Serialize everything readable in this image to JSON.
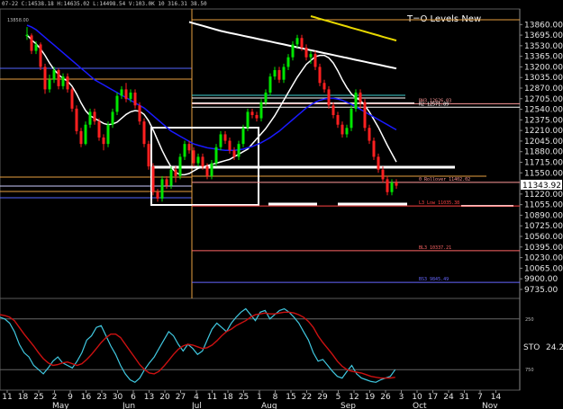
{
  "header": {
    "text": "07-22 C:14538.18 H:14635.02 L:14498.54 V:103.0K 10 316.31 38.50",
    "ref_value": "13858.00"
  },
  "chart_title": "T=O Levels New",
  "price_label": "11343.92",
  "chart_data": {
    "type": "candlestick",
    "price_axis": {
      "ylim": [
        9650,
        13990
      ],
      "ticks": [
        "13860.00",
        "13695.00",
        "13530.00",
        "13365.00",
        "13200.00",
        "13035.00",
        "12870.00",
        "12705.00",
        "12540.00",
        "12375.00",
        "12210.00",
        "12045.00",
        "11880.00",
        "11715.00",
        "11550.00",
        "11220.00",
        "11055.00",
        "10890.00",
        "10725.00",
        "10560.00",
        "10395.00",
        "10230.00",
        "10065.00",
        "9900.00",
        "9735.00"
      ]
    },
    "date_ticks": [
      "11",
      "18",
      "25",
      "2",
      "9",
      "16",
      "23",
      "30",
      "6",
      "13",
      "20",
      "27",
      "4",
      "11",
      "18",
      "25",
      "1",
      "8",
      "15",
      "22",
      "29",
      "5",
      "12",
      "19",
      "26",
      "3",
      "10",
      "17",
      "24",
      "31",
      "7",
      "14"
    ],
    "months": [
      "May",
      "Jun",
      "Jul",
      "Aug",
      "Sep",
      "Oct",
      "Nov"
    ],
    "candles": [
      [
        13680,
        13700,
        13820,
        13620
      ],
      [
        13690,
        13450,
        13720,
        13400
      ],
      [
        13450,
        13550,
        13600,
        13400
      ],
      [
        13550,
        13200,
        13580,
        13150
      ],
      [
        13200,
        12850,
        13250,
        12780
      ],
      [
        12850,
        13000,
        13080,
        12800
      ],
      [
        13000,
        13150,
        13200,
        12950
      ],
      [
        13150,
        12900,
        13180,
        12850
      ],
      [
        12900,
        13050,
        13100,
        12850
      ],
      [
        13050,
        12850,
        13100,
        12800
      ],
      [
        12850,
        12550,
        12880,
        12500
      ],
      [
        12550,
        12200,
        12600,
        12150
      ],
      [
        12200,
        12000,
        12250,
        11950
      ],
      [
        12000,
        12300,
        12350,
        11980
      ],
      [
        12300,
        12500,
        12550,
        12250
      ],
      [
        12500,
        12350,
        12550,
        12300
      ],
      [
        12350,
        12100,
        12400,
        12050
      ],
      [
        12100,
        12000,
        12150,
        11900
      ],
      [
        12000,
        12300,
        12350,
        11950
      ],
      [
        12300,
        12500,
        12550,
        12250
      ],
      [
        12500,
        12750,
        12800,
        12450
      ],
      [
        12750,
        12850,
        12900,
        12700
      ],
      [
        12850,
        12700,
        12950,
        12650
      ],
      [
        12700,
        12800,
        12850,
        12650
      ],
      [
        12800,
        12600,
        12850,
        12550
      ],
      [
        12600,
        12350,
        12650,
        12300
      ],
      [
        12350,
        12000,
        12400,
        11950
      ],
      [
        12000,
        11650,
        12050,
        11600
      ],
      [
        11650,
        11250,
        11700,
        11200
      ],
      [
        11250,
        11150,
        11300,
        11100
      ],
      [
        11150,
        11450,
        11500,
        11100
      ],
      [
        11450,
        11350,
        11500,
        11300
      ],
      [
        11350,
        11600,
        11650,
        11300
      ],
      [
        11600,
        11500,
        11650,
        11400
      ],
      [
        11500,
        11800,
        11850,
        11450
      ],
      [
        11800,
        12000,
        12050,
        11750
      ],
      [
        12000,
        11900,
        12050,
        11850
      ],
      [
        11900,
        11700,
        11950,
        11650
      ],
      [
        11700,
        11800,
        11850,
        11650
      ],
      [
        11800,
        11650,
        11850,
        11600
      ],
      [
        11650,
        11500,
        11700,
        11450
      ],
      [
        11500,
        11700,
        11750,
        11450
      ],
      [
        11700,
        11950,
        12000,
        11650
      ],
      [
        11950,
        12150,
        12200,
        11900
      ],
      [
        12150,
        12050,
        12200,
        12000
      ],
      [
        12050,
        11900,
        12100,
        11850
      ],
      [
        11900,
        11800,
        11950,
        11750
      ],
      [
        11800,
        12000,
        12050,
        11750
      ],
      [
        12000,
        12250,
        12300,
        11950
      ],
      [
        12250,
        12500,
        12550,
        12200
      ],
      [
        12500,
        12450,
        12550,
        12400
      ],
      [
        12450,
        12400,
        12500,
        12350
      ],
      [
        12400,
        12650,
        12700,
        12350
      ],
      [
        12650,
        12800,
        12850,
        12600
      ],
      [
        12800,
        13050,
        13100,
        12750
      ],
      [
        13050,
        13150,
        13200,
        13000
      ],
      [
        13150,
        13000,
        13200,
        12950
      ],
      [
        13000,
        13200,
        13250,
        12950
      ],
      [
        13200,
        13350,
        13400,
        13150
      ],
      [
        13350,
        13550,
        13600,
        13300
      ],
      [
        13550,
        13650,
        13700,
        13500
      ],
      [
        13650,
        13500,
        13700,
        13450
      ],
      [
        13500,
        13350,
        13550,
        13300
      ],
      [
        13350,
        13400,
        13450,
        13250
      ],
      [
        13400,
        13200,
        13450,
        13150
      ],
      [
        13200,
        12950,
        13250,
        12900
      ],
      [
        12950,
        12850,
        13000,
        12800
      ],
      [
        12850,
        12600,
        12900,
        12550
      ],
      [
        12600,
        12450,
        12650,
        12400
      ],
      [
        12450,
        12300,
        12500,
        12250
      ],
      [
        12300,
        12150,
        12350,
        12100
      ],
      [
        12150,
        12250,
        12300,
        12100
      ],
      [
        12250,
        12550,
        12600,
        12200
      ],
      [
        12550,
        12800,
        12850,
        12500
      ],
      [
        12800,
        12650,
        12850,
        12550
      ],
      [
        12650,
        12250,
        12700,
        12200
      ],
      [
        12250,
        12050,
        12300,
        12000
      ],
      [
        12050,
        11800,
        12100,
        11750
      ],
      [
        11800,
        11600,
        11850,
        11550
      ],
      [
        11600,
        11450,
        11650,
        11400
      ],
      [
        11450,
        11250,
        11500,
        11200
      ],
      [
        11250,
        11400,
        11450,
        11200
      ],
      [
        11400,
        11350,
        11450,
        11300
      ]
    ],
    "moving_averages": [
      {
        "color": "#ffffff",
        "values": [
          13700,
          13620,
          13560,
          13480,
          13380,
          13260,
          13160,
          13080,
          13020,
          12980,
          12900,
          12780,
          12640,
          12520,
          12440,
          12400,
          12360,
          12320,
          12300,
          12310,
          12340,
          12400,
          12460,
          12500,
          12520,
          12510,
          12460,
          12360,
          12220,
          12060,
          11900,
          11760,
          11640,
          11560,
          11520,
          11520,
          11540,
          11580,
          11620,
          11640,
          11660,
          11680,
          11700,
          11720,
          11740,
          11760,
          11800,
          11840,
          11880,
          11920,
          12000,
          12080,
          12160,
          12240,
          12340,
          12440,
          12560,
          12680,
          12800,
          12920,
          13040,
          13140,
          13240,
          13300,
          13360,
          13380,
          13380,
          13340,
          13260,
          13140,
          13000,
          12880,
          12780,
          12720,
          12680,
          12600,
          12500,
          12380,
          12260,
          12120,
          11980,
          11850,
          11720
        ]
      },
      {
        "color": "#1a1aff",
        "values": [
          13850,
          13820,
          13780,
          13720,
          13660,
          13600,
          13540,
          13480,
          13420,
          13360,
          13300,
          13240,
          13180,
          13120,
          13060,
          13000,
          12960,
          12920,
          12880,
          12840,
          12800,
          12760,
          12720,
          12680,
          12640,
          12600,
          12560,
          12500,
          12440,
          12380,
          12320,
          12260,
          12200,
          12160,
          12120,
          12080,
          12040,
          12000,
          11980,
          11960,
          11940,
          11930,
          11920,
          11910,
          11900,
          11900,
          11900,
          11910,
          11920,
          11940,
          11960,
          11990,
          12020,
          12060,
          12100,
          12150,
          12200,
          12260,
          12320,
          12380,
          12440,
          12500,
          12560,
          12610,
          12650,
          12680,
          12700,
          12710,
          12710,
          12700,
          12680,
          12650,
          12620,
          12580,
          12540,
          12500,
          12460,
          12420,
          12380,
          12340,
          12300,
          12260,
          12220
        ]
      },
      {
        "color": "#ffffff",
        "start": 36,
        "values": [
          13900,
          13880,
          13860,
          13840,
          13820,
          13800,
          13780,
          13760,
          13745,
          13730,
          13715,
          13700,
          13685,
          13670,
          13655,
          13640,
          13625,
          13610,
          13595,
          13580,
          13565,
          13550,
          13535,
          13520,
          13505,
          13490,
          13475,
          13460,
          13445,
          13430,
          13415,
          13400,
          13385,
          13370,
          13355,
          13340,
          13325,
          13310,
          13295,
          13280,
          13265,
          13250,
          13235,
          13220,
          13205,
          13190,
          13175
        ]
      },
      {
        "color": "#e8d800",
        "start": 63,
        "values": [
          13990,
          13970,
          13950,
          13930,
          13910,
          13890,
          13870,
          13850,
          13830,
          13810,
          13790,
          13770,
          13750,
          13730,
          13710,
          13690,
          13670,
          13650,
          13630,
          13610
        ]
      }
    ],
    "level_lines": [
      {
        "label": "BH3 12626.03",
        "value": 12626,
        "color": "#ff9999"
      },
      {
        "label": "R2 12571.89",
        "value": 12572,
        "color": "#ffffff"
      },
      {
        "label": "0 Rollover 11402.02",
        "value": 11402,
        "color": "#ff9999"
      },
      {
        "label": "L3 Low 11035.38",
        "value": 11035,
        "color": "#ff4444"
      },
      {
        "label": "BL3 10337.21",
        "value": 10337,
        "color": "#ff6666"
      },
      {
        "label": "BS3 9845.49",
        "value": 9845,
        "color": "#6666ff"
      }
    ],
    "stochastic": {
      "label": "STO",
      "value_label": "24.2",
      "ylim": [
        0,
        100
      ],
      "ref_levels": [
        {
          "label": "250",
          "value": 80
        },
        {
          "label": "750",
          "value": 20
        }
      ],
      "k": [
        82,
        80,
        75,
        65,
        50,
        40,
        35,
        25,
        20,
        15,
        22,
        30,
        35,
        28,
        25,
        22,
        30,
        40,
        55,
        60,
        70,
        72,
        60,
        48,
        38,
        25,
        15,
        8,
        5,
        10,
        20,
        28,
        35,
        45,
        55,
        65,
        60,
        50,
        42,
        50,
        45,
        38,
        42,
        55,
        68,
        75,
        70,
        65,
        75,
        82,
        88,
        92,
        85,
        78,
        88,
        90,
        80,
        85,
        90,
        92,
        88,
        82,
        75,
        65,
        55,
        40,
        30,
        32,
        25,
        18,
        12,
        10,
        18,
        25,
        15,
        10,
        8,
        6,
        5,
        8,
        10,
        12,
        20
      ],
      "d": [
        85,
        84,
        82,
        78,
        70,
        62,
        55,
        48,
        40,
        33,
        28,
        25,
        26,
        28,
        29,
        27,
        25,
        27,
        32,
        38,
        45,
        52,
        58,
        62,
        62,
        58,
        50,
        42,
        34,
        26,
        20,
        16,
        15,
        18,
        24,
        31,
        38,
        44,
        48,
        50,
        49,
        47,
        45,
        46,
        49,
        54,
        60,
        65,
        68,
        72,
        75,
        78,
        82,
        85,
        86,
        87,
        86,
        86,
        87,
        88,
        88,
        87,
        85,
        82,
        77,
        70,
        60,
        52,
        45,
        38,
        30,
        24,
        20,
        18,
        17,
        16,
        14,
        12,
        11,
        10,
        10,
        10,
        11
      ]
    }
  },
  "colors": {
    "background": "#000000",
    "up_candle": "#00e600",
    "down_candle": "#ff2020",
    "sto_k": "#40c8e0",
    "sto_d": "#cc1111"
  }
}
